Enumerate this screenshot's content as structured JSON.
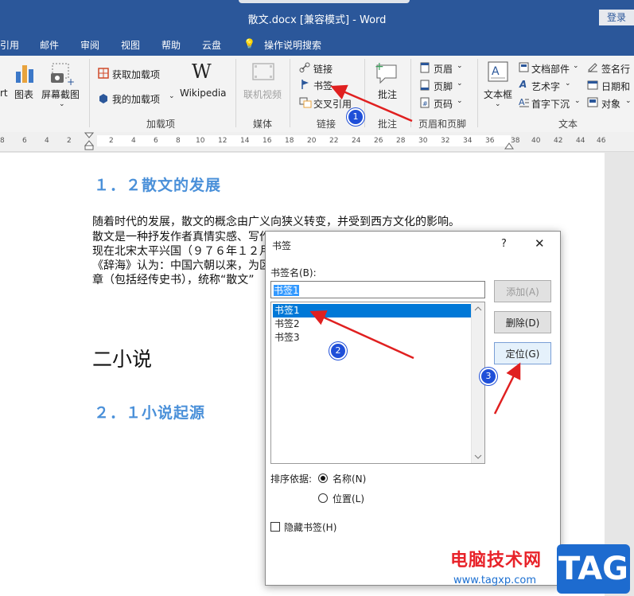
{
  "window": {
    "title": "散文.docx [兼容模式]  -  Word",
    "login_label": "登录"
  },
  "menu": [
    "引用",
    "邮件",
    "审阅",
    "视图",
    "帮助",
    "云盘",
    "操作说明搜索"
  ],
  "ribbon": {
    "illustrations": {
      "art_label": "rt",
      "chart_label": "图表",
      "screenshot_label": "屏幕截图"
    },
    "addins": {
      "get_addins": "获取加载项",
      "my_addins": "我的加载项",
      "wikipedia": "Wikipedia",
      "group": "加载项"
    },
    "media": {
      "online_video": "联机视频",
      "group": "媒体"
    },
    "links": {
      "link": "链接",
      "bookmark": "书签",
      "cross_ref": "交叉引用",
      "group": "链接"
    },
    "comments": {
      "comment": "批注",
      "group": "批注"
    },
    "header_footer": {
      "header": "页眉",
      "footer": "页脚",
      "page_number": "页码",
      "group": "页眉和页脚"
    },
    "text": {
      "textbox": "文本框",
      "doc_parts": "文档部件",
      "wordart": "艺术字",
      "dropcap": "首字下沉",
      "signature": "签名行",
      "datetime": "日期和",
      "object": "对象",
      "group": "文本"
    }
  },
  "ruler": {
    "left_ticks": [
      "8",
      "6",
      "4",
      "2"
    ],
    "ticks": [
      "2",
      "4",
      "6",
      "8",
      "10",
      "12",
      "14",
      "16",
      "18",
      "20",
      "22",
      "24",
      "26",
      "28",
      "30",
      "32",
      "34",
      "36",
      "38",
      "40",
      "42",
      "44",
      "46"
    ]
  },
  "document": {
    "heading_1_2": "１．２散文的发展",
    "para": [
      "随着时代的发展，散文的概念由广义向狭义转变，并受到西方文化的影响。",
      "散文是一种抒发作者真情实感、写作",
      "现在北宋太平兴国（９７６年１２月",
      "《辞海》认为：中国六朝以来，为区",
      "章（包括经传史书），统称“散文”"
    ],
    "heading_2": "二小说",
    "heading_2_1": "２．１小说起源"
  },
  "dialog": {
    "title": "书签",
    "help": "?",
    "close": "✕",
    "name_label": "书签名(B):",
    "name_value": "书签1",
    "items": [
      "书签1",
      "书签2",
      "书签3"
    ],
    "buttons": {
      "add": "添加(A)",
      "delete": "删除(D)",
      "goto": "定位(G)"
    },
    "sort_label": "排序依据:",
    "sort_options": [
      "名称(N)",
      "位置(L)"
    ],
    "hidden_label": "隐藏书签(H)"
  },
  "annotations": [
    "1",
    "2",
    "3"
  ],
  "watermark": {
    "name": "电脑技术网",
    "url": "www.tagxp.com",
    "tag": "TAG"
  }
}
